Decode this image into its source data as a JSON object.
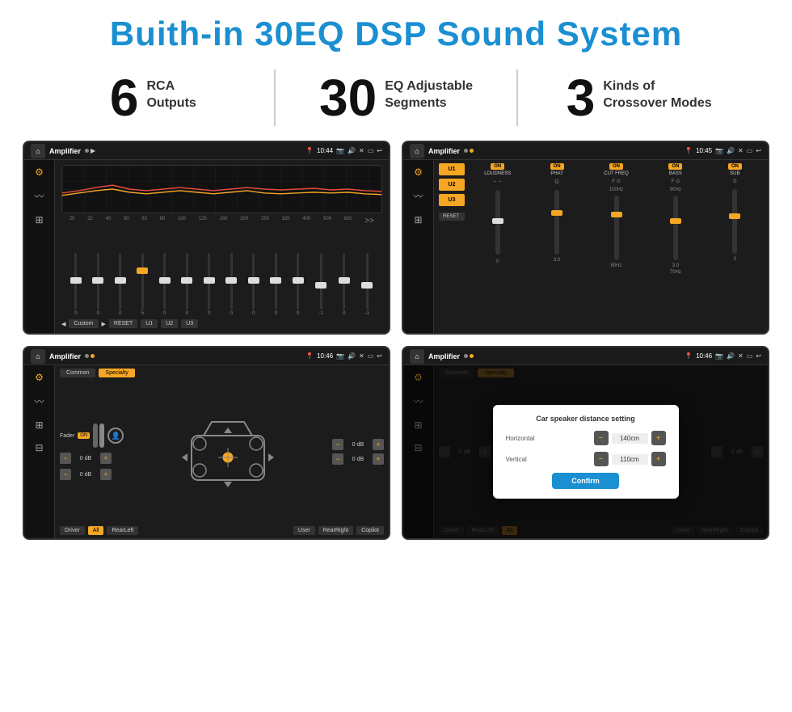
{
  "title": "Buith-in 30EQ DSP Sound System",
  "stats": [
    {
      "number": "6",
      "label": "RCA\nOutputs"
    },
    {
      "number": "30",
      "label": "EQ Adjustable\nSegments"
    },
    {
      "number": "3",
      "label": "Kinds of\nCrossover Modes"
    }
  ],
  "screens": [
    {
      "id": "screen1",
      "title": "Amplifier",
      "time": "10:44",
      "type": "eq",
      "eq_labels": [
        "25",
        "32",
        "40",
        "50",
        "63",
        "80",
        "100",
        "125",
        "160",
        "200",
        "250",
        "320",
        "400",
        "500",
        "630"
      ],
      "eq_values": [
        "0",
        "0",
        "0",
        "5",
        "0",
        "0",
        "0",
        "0",
        "0",
        "0",
        "0",
        "-1",
        "0",
        "-1"
      ]
    },
    {
      "id": "screen2",
      "title": "Amplifier",
      "time": "10:45",
      "type": "amp",
      "presets": [
        "U1",
        "U2",
        "U3"
      ],
      "channels": [
        {
          "label": "LOUDNESS",
          "on": true
        },
        {
          "label": "PHAT",
          "on": true
        },
        {
          "label": "CUT FREQ",
          "on": true
        },
        {
          "label": "BASS",
          "on": true
        },
        {
          "label": "SUB",
          "on": true
        }
      ]
    },
    {
      "id": "screen3",
      "title": "Amplifier",
      "time": "10:46",
      "type": "crossover",
      "tabs": [
        "Common",
        "Specialty"
      ],
      "fader_label": "Fader",
      "on": "ON",
      "db_values": [
        "0 dB",
        "0 dB",
        "0 dB",
        "0 dB"
      ],
      "buttons": [
        "Driver",
        "All",
        "RearLeft",
        "User",
        "RearRight",
        "Copilot"
      ]
    },
    {
      "id": "screen4",
      "title": "Amplifier",
      "time": "10:46",
      "type": "crossover_dialog",
      "tabs": [
        "Common",
        "Specialty"
      ],
      "dialog": {
        "title": "Car speaker distance setting",
        "horizontal_label": "Horizontal",
        "horizontal_value": "140cm",
        "vertical_label": "Vertical",
        "vertical_value": "110cm",
        "confirm_label": "Confirm"
      },
      "db_values": [
        "0 dB",
        "0 dB"
      ],
      "buttons": [
        "Driver",
        "RearLeft",
        "All",
        "User",
        "RearRight",
        "Copilot"
      ]
    }
  ]
}
